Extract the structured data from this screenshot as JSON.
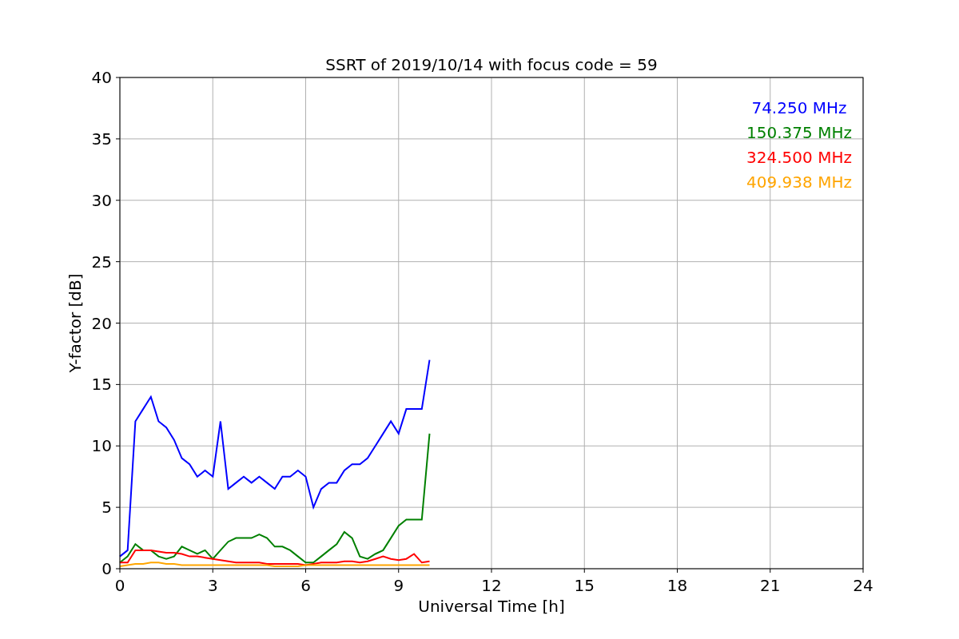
{
  "chart_data": {
    "type": "line",
    "title": "SSRT of 2019/10/14 with focus code = 59",
    "xlabel": "Universal Time [h]",
    "ylabel": "Y-factor [dB]",
    "x": [
      0,
      0.25,
      0.5,
      0.75,
      1,
      1.25,
      1.5,
      1.75,
      2,
      2.25,
      2.5,
      2.75,
      3,
      3.25,
      3.5,
      3.75,
      4,
      4.25,
      4.5,
      4.75,
      5,
      5.25,
      5.5,
      5.75,
      6,
      6.25,
      6.5,
      6.75,
      7,
      7.25,
      7.5,
      7.75,
      8,
      8.25,
      8.5,
      8.75,
      9,
      9.25,
      9.5,
      9.75,
      10
    ],
    "series": [
      {
        "name": "74.250 MHz",
        "color": "#0000ff",
        "values": [
          1,
          1.5,
          12,
          13,
          14,
          12,
          11.5,
          10.5,
          9,
          8.5,
          7.5,
          8,
          7.5,
          12,
          6.5,
          7,
          7.5,
          7,
          7.5,
          7,
          6.5,
          7.5,
          7.5,
          8,
          7.5,
          5,
          6.5,
          7,
          7,
          8,
          8.5,
          8.5,
          9,
          10,
          11,
          12,
          11,
          13,
          13,
          13,
          17
        ]
      },
      {
        "name": "150.375 MHz",
        "color": "#008000",
        "values": [
          0.5,
          1,
          2,
          1.5,
          1.5,
          1,
          0.8,
          1,
          1.8,
          1.5,
          1.2,
          1.5,
          0.8,
          1.5,
          2.2,
          2.5,
          2.5,
          2.5,
          2.8,
          2.5,
          1.8,
          1.8,
          1.5,
          1,
          0.5,
          0.5,
          1,
          1.5,
          2,
          3,
          2.5,
          1,
          0.8,
          1.2,
          1.5,
          2.5,
          3.5,
          4,
          4,
          4,
          11
        ]
      },
      {
        "name": "324.500 MHz",
        "color": "#ff0000",
        "values": [
          0.5,
          0.5,
          1.5,
          1.5,
          1.5,
          1.4,
          1.3,
          1.3,
          1.2,
          1,
          1,
          0.9,
          0.8,
          0.7,
          0.6,
          0.5,
          0.5,
          0.5,
          0.5,
          0.4,
          0.4,
          0.4,
          0.4,
          0.4,
          0.3,
          0.4,
          0.5,
          0.5,
          0.5,
          0.6,
          0.6,
          0.5,
          0.6,
          0.8,
          1,
          0.8,
          0.7,
          0.8,
          1.2,
          0.5,
          0.6
        ]
      },
      {
        "name": "409.938 MHz",
        "color": "#ffa500",
        "values": [
          0.2,
          0.3,
          0.4,
          0.4,
          0.5,
          0.5,
          0.4,
          0.4,
          0.3,
          0.3,
          0.3,
          0.3,
          0.3,
          0.3,
          0.3,
          0.3,
          0.3,
          0.3,
          0.3,
          0.3,
          0.2,
          0.2,
          0.2,
          0.2,
          0.3,
          0.3,
          0.3,
          0.3,
          0.3,
          0.3,
          0.3,
          0.3,
          0.3,
          0.3,
          0.3,
          0.3,
          0.3,
          0.3,
          0.3,
          0.3,
          0.3
        ]
      }
    ],
    "grid": true,
    "xlim": [
      0,
      24
    ],
    "ylim": [
      0,
      40
    ],
    "xticks": [
      0,
      3,
      6,
      9,
      12,
      15,
      18,
      21,
      24
    ],
    "yticks": [
      0,
      5,
      10,
      15,
      20,
      25,
      30,
      35,
      40
    ]
  }
}
